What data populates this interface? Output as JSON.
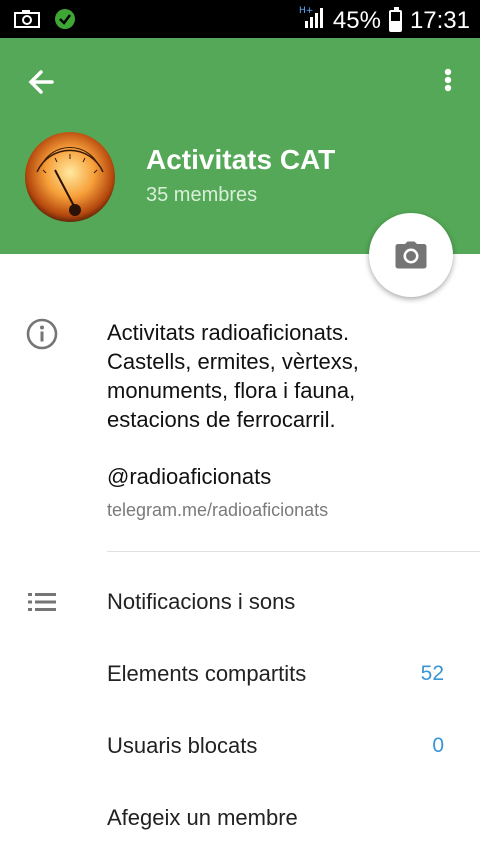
{
  "status_bar": {
    "battery": "45%",
    "time": "17:31",
    "battery_level": 0.45
  },
  "header": {
    "group_name": "Activitats CAT",
    "members": "35 membres",
    "color": "#54a857"
  },
  "info": {
    "description_lines": [
      "Activitats radioaficionats.",
      "Castells, ermites, vèrtexs,",
      "monuments, flora i fauna,",
      "estacions de ferrocarril."
    ],
    "username": "@radioaficionats",
    "link": "telegram.me/radioaficionats"
  },
  "settings": {
    "notifications_label": "Notificacions i sons",
    "shared_label": "Elements compartits",
    "shared_count": "52",
    "blocked_label": "Usuaris blocats",
    "blocked_count": "0",
    "add_member_label": "Afegeix un membre"
  },
  "icons": {
    "back": "arrow-left-icon",
    "menu": "more-vertical-icon",
    "camera": "camera-icon",
    "info": "info-icon",
    "list": "list-icon"
  }
}
